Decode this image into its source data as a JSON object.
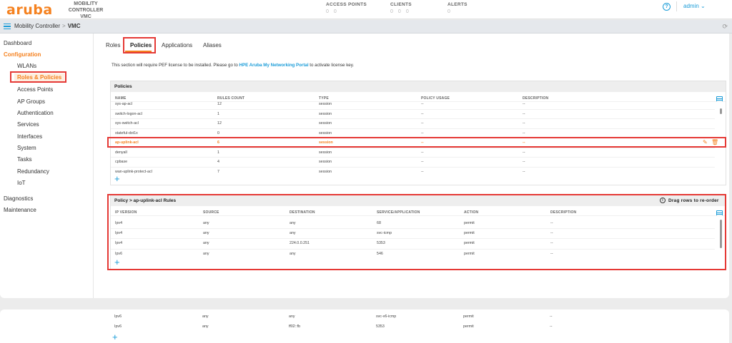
{
  "header": {
    "logo": "aruba",
    "mc_line1": "MOBILITY CONTROLLER",
    "mc_line2": "VMC",
    "access_points": {
      "title": "ACCESS POINTS",
      "v1": "0",
      "v2": "0"
    },
    "clients": {
      "title": "CLIENTS",
      "v1": "0",
      "v2": "0",
      "v3": "0"
    },
    "alerts": {
      "title": "ALERTS",
      "v1": "0"
    },
    "user": "admin ⌄",
    "help": "?"
  },
  "breadcrumb": {
    "root": "Mobility Controller",
    "sep": ">",
    "current": "VMC"
  },
  "sidebar": {
    "dashboard": "Dashboard",
    "configuration": "Configuration",
    "items": [
      "WLANs",
      "Roles & Policies",
      "Access Points",
      "AP Groups",
      "Authentication",
      "Services",
      "Interfaces",
      "System",
      "Tasks",
      "Redundancy",
      "IoT"
    ],
    "diagnostics": "Diagnostics",
    "maintenance": "Maintenance"
  },
  "tabs": [
    "Roles",
    "Policies",
    "Applications",
    "Aliases"
  ],
  "license": {
    "pre": "This section will require PEF license to be installed. Please go to ",
    "link": "HPE Aruba My Networking Portal",
    "post": " to activate license key."
  },
  "policies": {
    "title": "Policies",
    "columns": [
      "NAME",
      "RULES COUNT",
      "TYPE",
      "POLICY USAGE",
      "DESCRIPTION"
    ],
    "rows": [
      [
        "sys-ap-acl",
        "12",
        "session",
        "--",
        "--"
      ],
      [
        "switch-logon-acl",
        "1",
        "session",
        "--",
        "--"
      ],
      [
        "sys-switch-acl",
        "12",
        "session",
        "--",
        "--"
      ],
      [
        "stateful-dot1x",
        "0",
        "session",
        "--",
        "--"
      ],
      [
        "ap-uplink-acl",
        "6",
        "session",
        "--",
        "--"
      ],
      [
        "denyall",
        "1",
        "session",
        "--",
        "--"
      ],
      [
        "cpbase",
        "4",
        "session",
        "--",
        "--"
      ],
      [
        "wan-uplink-protect-acl",
        "7",
        "session",
        "--",
        "--"
      ]
    ]
  },
  "rules": {
    "title": "Policy > ap-uplink-acl Rules",
    "drag_hint": "Drag rows to re-order",
    "columns": [
      "IP VERSION",
      "SOURCE",
      "DESTINATION",
      "SERVICE/APPLICATION",
      "ACTION",
      "DESCRIPTION"
    ],
    "rows": [
      [
        "Ipv4",
        "any",
        "any",
        "68",
        "permit",
        "--"
      ],
      [
        "Ipv4",
        "any",
        "any",
        "svc-icmp",
        "permit",
        "--"
      ],
      [
        "Ipv4",
        "any",
        "224.0.0.251",
        "5353",
        "permit",
        "--"
      ],
      [
        "Ipv6",
        "any",
        "any",
        "546",
        "permit",
        "--"
      ]
    ],
    "overflow_rows": [
      [
        "Ipv6",
        "any",
        "any",
        "svc-v6-icmp",
        "permit",
        "--"
      ],
      [
        "Ipv6",
        "any",
        "ff02::fb",
        "5353",
        "permit",
        "--"
      ]
    ]
  },
  "add_symbol": "+",
  "colors": {
    "accent": "#f58220",
    "link": "#1a9cd8",
    "highlight_box": "#e53935"
  }
}
